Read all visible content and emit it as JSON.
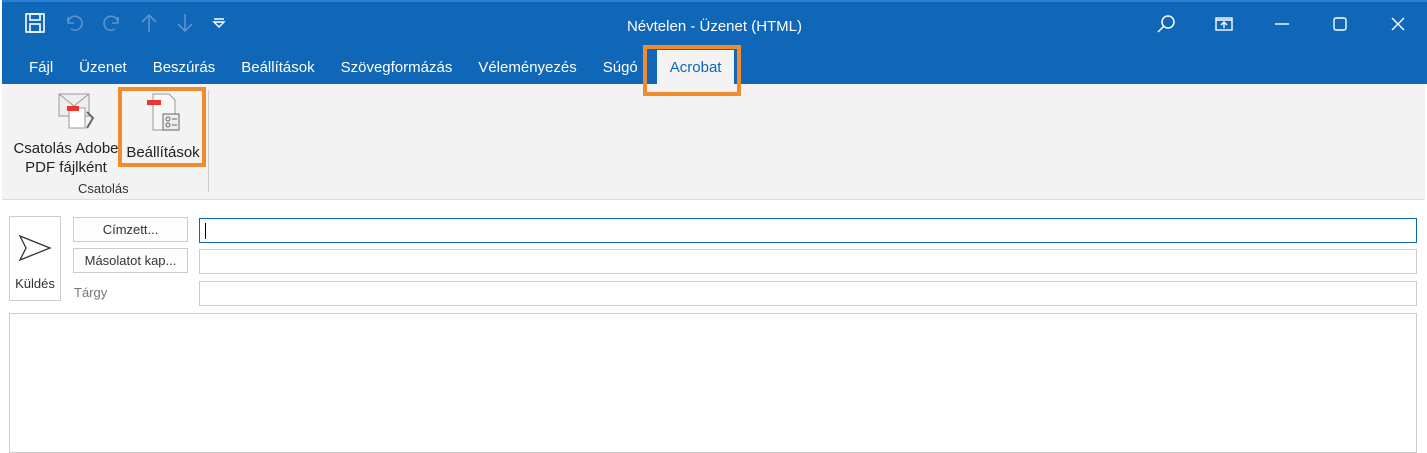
{
  "window": {
    "title": "Névtelen  -  Üzenet (HTML)"
  },
  "tabs": [
    {
      "label": "Fájl"
    },
    {
      "label": "Üzenet"
    },
    {
      "label": "Beszúrás"
    },
    {
      "label": "Beállítások"
    },
    {
      "label": "Szövegformázás"
    },
    {
      "label": "Véleményezés"
    },
    {
      "label": "Súgó"
    },
    {
      "label": "Acrobat"
    }
  ],
  "ribbon": {
    "attach_pdf_line1": "Csatolás Adobe",
    "attach_pdf_line2": "PDF fájlként",
    "settings": "Beállítások",
    "group_label": "Csatolás"
  },
  "compose": {
    "send": "Küldés",
    "to_button": "Címzett...",
    "cc_button": "Másolatot kap...",
    "subject_label": "Tárgy",
    "to_value": "",
    "cc_value": "",
    "subject_value": ""
  },
  "colors": {
    "accent": "#1066b7",
    "highlight": "#f28a30"
  }
}
